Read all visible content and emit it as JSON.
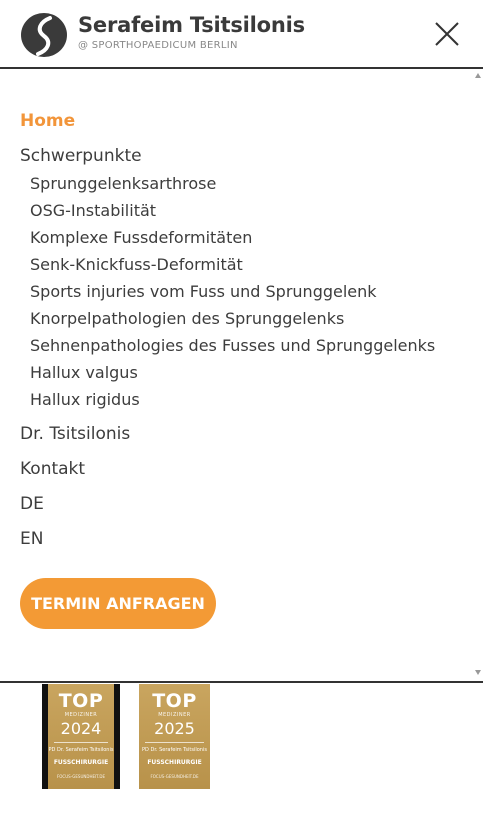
{
  "header": {
    "brand_name": "Serafeim Tsitsilonis",
    "brand_sub": "@ SPORTHOPAEDICUM BERLIN"
  },
  "nav": {
    "home": "Home",
    "focus": "Schwerpunkte",
    "sub_items": [
      "Sprunggelenksarthrose",
      "OSG-Instabilität",
      "Komplexe Fussdeformitäten",
      "Senk-Knickfuss-Deformität",
      "Sports injuries vom Fuss und Sprunggelenk",
      "Knorpelpathologien des Sprunggelenks",
      "Sehnenpathologies des Fusses und Sprunggelenks",
      "Hallux valgus",
      "Hallux rigidus"
    ],
    "doctor": "Dr. Tsitsilonis",
    "contact": "Kontakt",
    "lang_de": "DE",
    "lang_en": "EN",
    "cta": "TERMIN ANFRAGEN"
  },
  "badges": [
    {
      "top": "TOP",
      "med": "MEDIZINER",
      "year": "2024",
      "doc": "PD Dr. Serafeim Tsitsilonis",
      "spec": "FUSSCHIRURGIE",
      "foot": "FOCUS-GESUNDHEIT.DE"
    },
    {
      "top": "TOP",
      "med": "MEDIZINER",
      "year": "2025",
      "doc": "PD Dr. Serafeim Tsitsilonis",
      "spec": "FUSSCHIRURGIE",
      "foot": "FOCUS-GESUNDHEIT.DE"
    }
  ],
  "colors": {
    "accent": "#f39a35",
    "text": "#3d3d3d",
    "badge_gold": "#c9a55f"
  },
  "icons": {
    "logo": "logo-mark-icon",
    "close": "close-icon"
  }
}
